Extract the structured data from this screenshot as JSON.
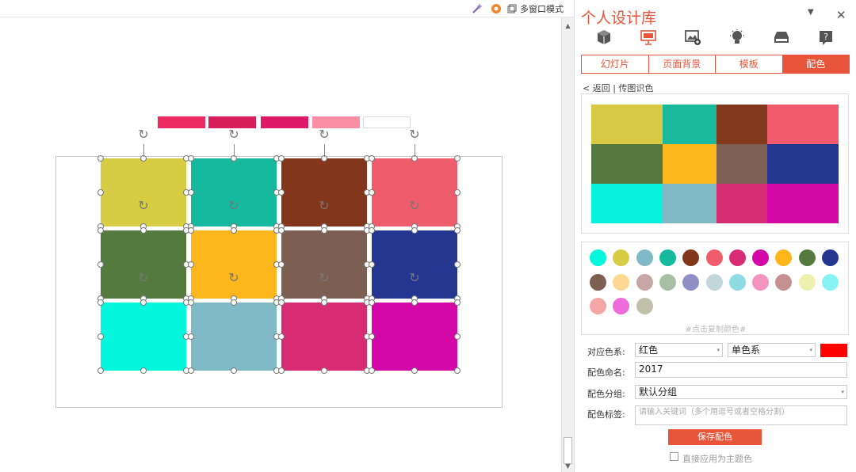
{
  "toolbar": {
    "multi_window_label": "多窗口模式",
    "icons": [
      "magic-wand-icon",
      "gear-icon",
      "window-icon"
    ]
  },
  "canvas": {
    "top_bar_colors": [
      "#ee2a62",
      "#d81e5b",
      "#e0186a",
      "#fa8ea4",
      "#ffffff"
    ],
    "tiles": [
      "#d6cd45",
      "#16b99e",
      "#82371c",
      "#ef5c6b",
      "#557a3f",
      "#fdb71d",
      "#7c5e52",
      "#24368f",
      "#04f6dc",
      "#80bac7",
      "#d72c74",
      "#d308a6"
    ]
  },
  "panel": {
    "title": "个人设计库",
    "icons": [
      "cube-icon",
      "slide-icon",
      "image-add-icon",
      "lightbulb-icon",
      "drive-icon",
      "help-icon"
    ],
    "tabs": [
      {
        "label": "幻灯片",
        "active": false
      },
      {
        "label": "页面背景",
        "active": false
      },
      {
        "label": "模板",
        "active": false
      },
      {
        "label": "配色",
        "active": true
      }
    ],
    "breadcrumb": "< 返回 | 传图识色",
    "extracted_colors": [
      "#04f6dc",
      "#d6cd45",
      "#80bac7",
      "#16b99e",
      "#82371c",
      "#ef5c6b",
      "#d72c74",
      "#d308a6",
      "#fdb71d",
      "#557a3f",
      "#24368f",
      "#7c5e52",
      "#fed792",
      "#c7a6a6",
      "#a9bfa5",
      "#8f8fc6",
      "#c3d6dc",
      "#8fdbe3",
      "#f394c0",
      "#c49190",
      "#eef0b0",
      "#87f3f4",
      "#f4a5a6",
      "#ee6bdc",
      "#c0c0ab"
    ],
    "swatch_hint": "#点击复制颜色#",
    "form": {
      "color_family_label": "对应色系:",
      "color_family_value": "红色",
      "color_type_value": "单色系",
      "accent_color": "#ff0000",
      "name_label": "配色命名:",
      "name_value": "2017",
      "group_label": "配色分组:",
      "group_value": "默认分组",
      "tags_label": "配色标签:",
      "tags_placeholder": "请输入关键词（多个用逗号或者空格分割）",
      "save_label": "保存配色",
      "apply_label": "直接应用为主题色"
    }
  }
}
